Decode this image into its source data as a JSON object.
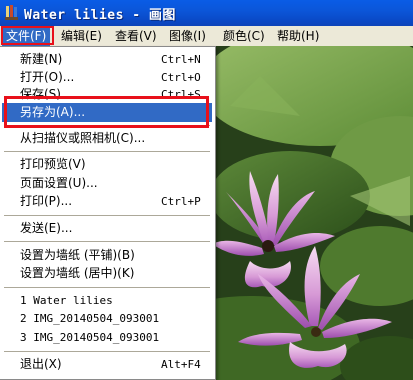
{
  "window": {
    "title": "Water lilies - 画图"
  },
  "menubar": [
    {
      "label": "文件(F)"
    },
    {
      "label": "编辑(E)"
    },
    {
      "label": "查看(V)"
    },
    {
      "label": "图像(I)"
    },
    {
      "label": "颜色(C)"
    },
    {
      "label": "帮助(H)"
    }
  ],
  "file_menu": {
    "items": [
      {
        "label": "新建(N)",
        "shortcut": "Ctrl+N"
      },
      {
        "label": "打开(O)...",
        "shortcut": "Ctrl+O"
      },
      {
        "label": "保存(S)",
        "shortcut": "Ctrl+S"
      },
      {
        "label": "另存为(A)...",
        "shortcut": ""
      },
      {
        "label": "从扫描仪或照相机(C)...",
        "shortcut": ""
      },
      {
        "label": "打印预览(V)",
        "shortcut": ""
      },
      {
        "label": "页面设置(U)...",
        "shortcut": ""
      },
      {
        "label": "打印(P)...",
        "shortcut": "Ctrl+P"
      },
      {
        "label": "发送(E)...",
        "shortcut": ""
      },
      {
        "label": "设置为墙纸 (平铺)(B)",
        "shortcut": ""
      },
      {
        "label": "设置为墙纸 (居中)(K)",
        "shortcut": ""
      },
      {
        "label": "1 Water lilies",
        "shortcut": ""
      },
      {
        "label": "2 IMG_20140504_093001",
        "shortcut": ""
      },
      {
        "label": "3 IMG_20140504_093001",
        "shortcut": ""
      },
      {
        "label": "退出(X)",
        "shortcut": "Alt+F4"
      }
    ]
  },
  "colors": {
    "highlight": "#316ac5",
    "annotation_box": "#e8101a",
    "titlebar": "#0a5ce6"
  }
}
